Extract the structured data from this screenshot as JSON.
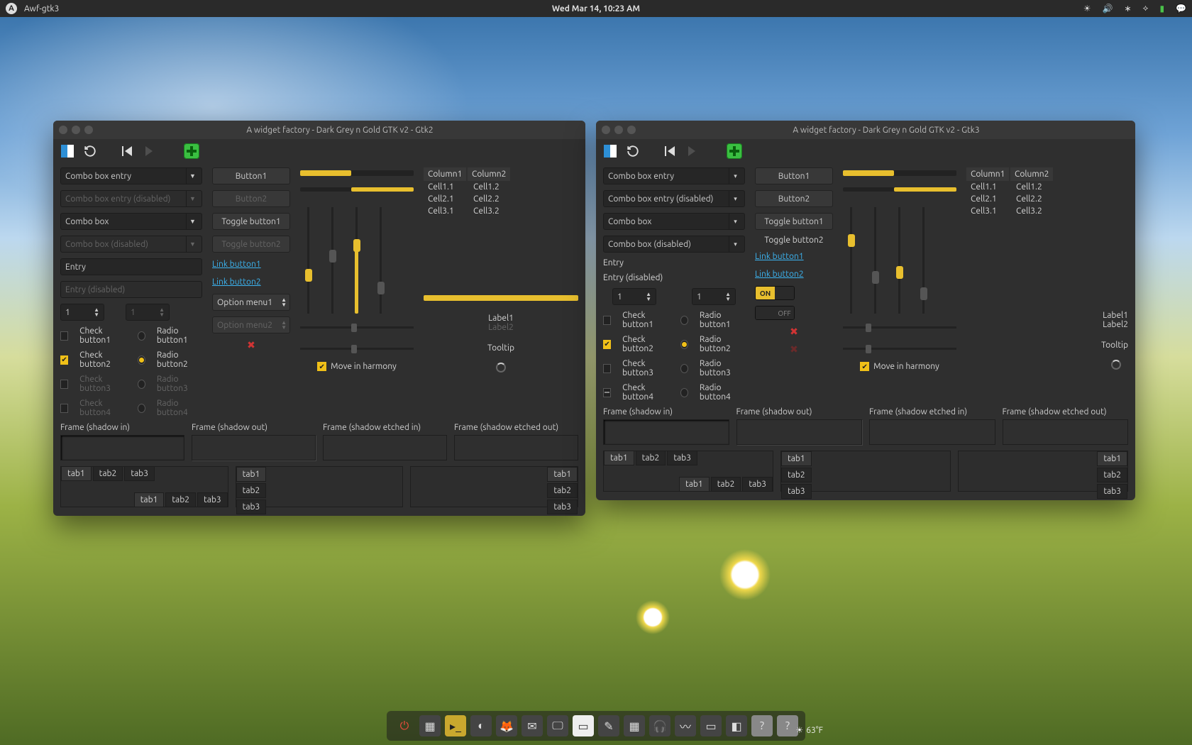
{
  "colors": {
    "accent": "#e8bf2e",
    "bg": "#2f2f2f",
    "link": "#3cb5f2"
  },
  "topbar": {
    "app_name": "Awf-gtk3",
    "clock": "Wed Mar 14, 10:23 AM"
  },
  "temperature": "63°F",
  "win_gtk2": {
    "title": "A widget factory - Dark Grey n Gold GTK v2 - Gtk2"
  },
  "win_gtk3": {
    "title": "A widget factory - Dark Grey n Gold GTK v2 - Gtk3"
  },
  "combos": {
    "entry": "Combo box entry",
    "entry_disabled": "Combo box entry (disabled)",
    "box": "Combo box",
    "box_disabled": "Combo box (disabled)"
  },
  "entries": {
    "placeholder": "Entry",
    "disabled": "Entry (disabled)"
  },
  "spin_value": "1",
  "buttons": {
    "b1": "Button1",
    "b2": "Button2",
    "tog1": "Toggle button1",
    "tog2": "Toggle button2",
    "link1": "Link button1",
    "link2": "Link button2",
    "opt1": "Option menu1",
    "opt2": "Option menu2"
  },
  "switch": {
    "on": "ON",
    "off": "OFF"
  },
  "checks": {
    "c1": "Check button1",
    "c2": "Check button2",
    "c3": "Check button3",
    "c4": "Check button4",
    "r1": "Radio button1",
    "r2": "Radio button2",
    "r3": "Radio button3",
    "r4": "Radio button4"
  },
  "harmony": "Move in harmony",
  "table": {
    "headers": [
      "Column1",
      "Column2"
    ],
    "rows": [
      [
        "Cell1.1",
        "Cell1.2"
      ],
      [
        "Cell2.1",
        "Cell2.2"
      ],
      [
        "Cell3.1",
        "Cell3.2"
      ]
    ]
  },
  "labels": {
    "l1": "Label1",
    "l2": "Label2",
    "tooltip": "Tooltip"
  },
  "frames": {
    "in": "Frame (shadow in)",
    "out": "Frame (shadow out)",
    "ein": "Frame (shadow etched in)",
    "eout": "Frame (shadow etched out)"
  },
  "tabs": {
    "t1": "tab1",
    "t2": "tab2",
    "t3": "tab3"
  }
}
